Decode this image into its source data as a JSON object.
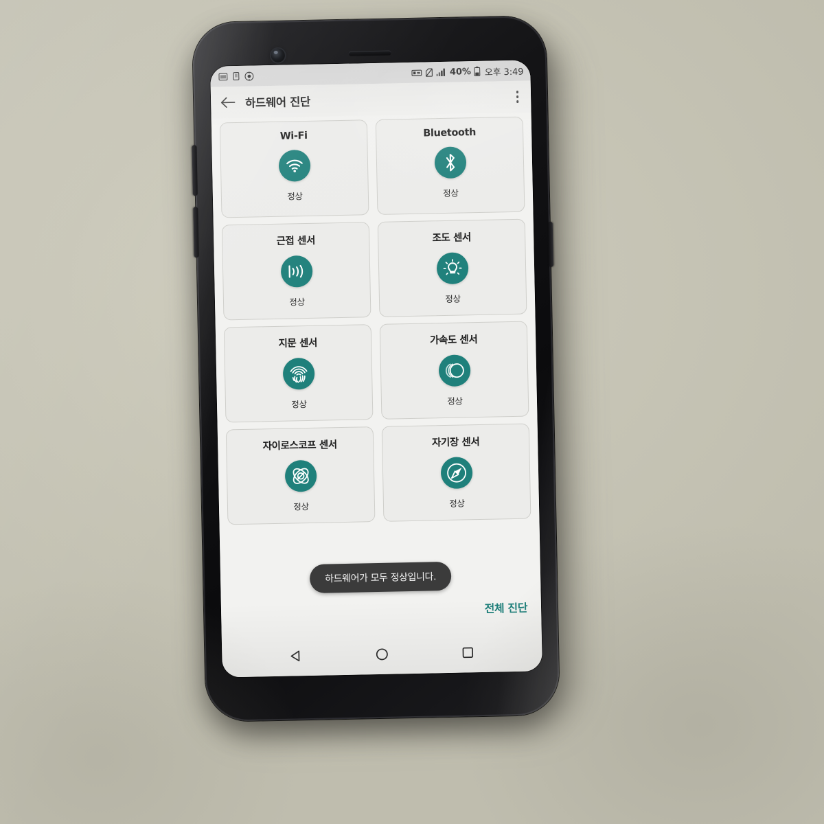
{
  "device": {
    "type": "smartphone",
    "body_color": "#141416",
    "surface_color": "#c7c5b6"
  },
  "status_bar": {
    "left_icons": [
      "sd-card-icon",
      "sim-card-icon",
      "eye-care-icon"
    ],
    "right_icons": [
      "screenshot-icon",
      "no-sim-icon",
      "signal-bars-icon",
      "battery-icon"
    ],
    "battery_percent": "40%",
    "clock": "오후 3:49"
  },
  "app_bar": {
    "back_label": "back-arrow",
    "title": "하드웨어 진단",
    "overflow_label": "more-options"
  },
  "diagnostics": {
    "cards": [
      {
        "title": "Wi-Fi",
        "status": "정상",
        "icon": "wifi-icon"
      },
      {
        "title": "Bluetooth",
        "status": "정상",
        "icon": "bluetooth-icon"
      },
      {
        "title": "근접 센서",
        "status": "정상",
        "icon": "proximity-sensor-icon"
      },
      {
        "title": "조도 센서",
        "status": "정상",
        "icon": "light-sensor-icon"
      },
      {
        "title": "지문 센서",
        "status": "정상",
        "icon": "fingerprint-icon"
      },
      {
        "title": "가속도 센서",
        "status": "정상",
        "icon": "accelerometer-icon"
      },
      {
        "title": "자이로스코프 센서",
        "status": "정상",
        "icon": "gyroscope-icon"
      },
      {
        "title": "자기장 센서",
        "status": "정상",
        "icon": "magnetometer-icon"
      }
    ]
  },
  "toast": {
    "message": "하드웨어가 모두 정상입니다."
  },
  "action": {
    "label": "전체 진단"
  },
  "nav_bar": {
    "back": "back-nav-icon",
    "home": "home-nav-icon",
    "recents": "recents-nav-icon"
  },
  "colors": {
    "accent_teal": "#1f807b",
    "card_bg": "#ececea",
    "screen_bg": "#f2f2f0",
    "toast_bg": "#3b3b3b"
  }
}
